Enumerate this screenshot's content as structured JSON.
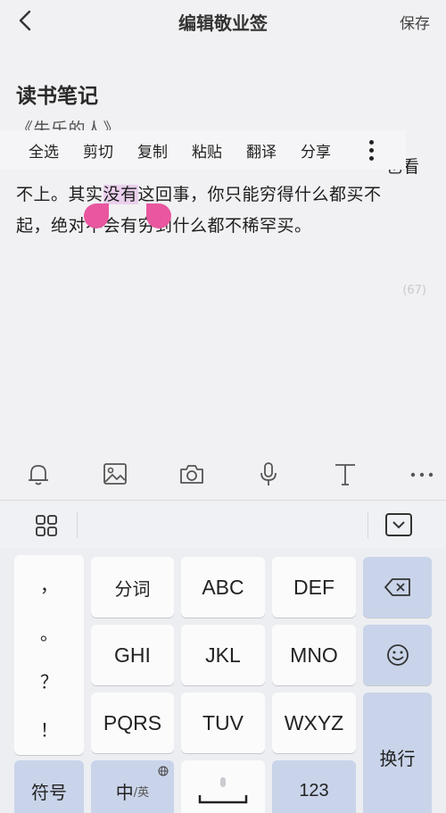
{
  "header": {
    "title": "编辑敬业签",
    "save_label": "保存"
  },
  "note": {
    "title": "读书笔记",
    "line1": "《失乐的人》",
    "line1_tail": "也看",
    "line2_before": "不上。其实",
    "line2_selected": "没有",
    "line2_after": "这回事，你只能穷得什么都买不",
    "line3": "起，绝对不会有穷到什么都不稀罕买。",
    "char_count": "(67)"
  },
  "context_menu": {
    "items": [
      "全选",
      "剪切",
      "复制",
      "粘贴",
      "翻译",
      "分享"
    ]
  },
  "toolbar": {
    "icons": [
      "bell-icon",
      "image-icon",
      "camera-icon",
      "microphone-icon",
      "text-format-icon",
      "more-icon"
    ]
  },
  "keyboard": {
    "punctuation": [
      "，",
      "。",
      "？",
      "！"
    ],
    "row1": [
      "分词",
      "ABC",
      "DEF"
    ],
    "row2": [
      "GHI",
      "JKL",
      "MNO"
    ],
    "row3": [
      "PQRS",
      "TUV",
      "WXYZ"
    ],
    "symbol_label": "符号",
    "lang_main": "中",
    "lang_sub": "/英",
    "num_label": "123",
    "enter_label": "换行"
  },
  "colors": {
    "selection": "#ead0ec",
    "handle": "#e8579f",
    "key_blue": "#c9d4ea"
  }
}
